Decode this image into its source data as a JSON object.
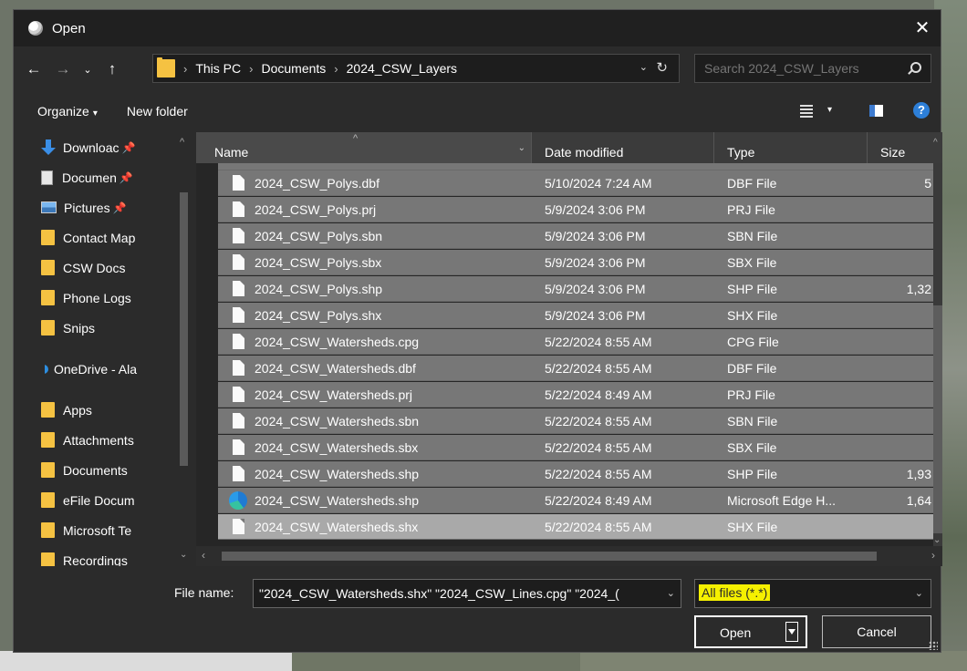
{
  "window": {
    "title": "Open",
    "close_glyph": "✕",
    "icon": "app-icon"
  },
  "address": {
    "back_glyph": "←",
    "forward_glyph": "→",
    "recent_glyph": "⌄",
    "up_glyph": "↑",
    "crumb_sep": "›",
    "crumbs": [
      "This PC",
      "Documents",
      "2024_CSW_Layers"
    ],
    "dropdown_glyph": "⌄",
    "refresh_glyph": "↻",
    "search_placeholder": "Search 2024_CSW_Layers"
  },
  "toolbar": {
    "organize_label": "Organize",
    "new_folder_label": "New folder",
    "caret_glyph": "▾",
    "help_glyph": "?"
  },
  "nav": {
    "pin_glyph": "📌",
    "items": [
      {
        "label": "Downloac",
        "icon": "download-icon",
        "pinned": true
      },
      {
        "label": "Documen",
        "icon": "documents-icon",
        "pinned": true
      },
      {
        "label": "Pictures",
        "icon": "pictures-icon",
        "pinned": true
      },
      {
        "label": "Contact Map",
        "icon": "folder-icon"
      },
      {
        "label": "CSW Docs",
        "icon": "folder-icon"
      },
      {
        "label": "Phone Logs",
        "icon": "folder-icon"
      },
      {
        "label": "Snips",
        "icon": "folder-icon"
      },
      {
        "label": "OneDrive - Ala",
        "icon": "onedrive-icon"
      },
      {
        "label": "Apps",
        "icon": "folder-icon"
      },
      {
        "label": "Attachments",
        "icon": "folder-icon"
      },
      {
        "label": "Documents",
        "icon": "folder-icon"
      },
      {
        "label": "eFile Docum",
        "icon": "folder-icon"
      },
      {
        "label": "Microsoft Te",
        "icon": "folder-icon"
      },
      {
        "label": "Recordings",
        "icon": "folder-icon"
      }
    ]
  },
  "columns": {
    "name": "Name",
    "date": "Date modified",
    "type": "Type",
    "size": "Size"
  },
  "files": [
    {
      "name": "2024_CSW_Polys.dbf",
      "date": "5/10/2024 7:24 AM",
      "type": "DBF File",
      "size": "5",
      "icon": "file-icon"
    },
    {
      "name": "2024_CSW_Polys.prj",
      "date": "5/9/2024 3:06 PM",
      "type": "PRJ File",
      "size": "",
      "icon": "file-icon"
    },
    {
      "name": "2024_CSW_Polys.sbn",
      "date": "5/9/2024 3:06 PM",
      "type": "SBN File",
      "size": "",
      "icon": "file-icon"
    },
    {
      "name": "2024_CSW_Polys.sbx",
      "date": "5/9/2024 3:06 PM",
      "type": "SBX File",
      "size": "",
      "icon": "file-icon"
    },
    {
      "name": "2024_CSW_Polys.shp",
      "date": "5/9/2024 3:06 PM",
      "type": "SHP File",
      "size": "1,32",
      "icon": "file-icon"
    },
    {
      "name": "2024_CSW_Polys.shx",
      "date": "5/9/2024 3:06 PM",
      "type": "SHX File",
      "size": "",
      "icon": "file-icon"
    },
    {
      "name": "2024_CSW_Watersheds.cpg",
      "date": "5/22/2024 8:55 AM",
      "type": "CPG File",
      "size": "",
      "icon": "file-icon"
    },
    {
      "name": "2024_CSW_Watersheds.dbf",
      "date": "5/22/2024 8:55 AM",
      "type": "DBF File",
      "size": "",
      "icon": "file-icon"
    },
    {
      "name": "2024_CSW_Watersheds.prj",
      "date": "5/22/2024 8:49 AM",
      "type": "PRJ File",
      "size": "",
      "icon": "file-icon"
    },
    {
      "name": "2024_CSW_Watersheds.sbn",
      "date": "5/22/2024 8:55 AM",
      "type": "SBN File",
      "size": "",
      "icon": "file-icon"
    },
    {
      "name": "2024_CSW_Watersheds.sbx",
      "date": "5/22/2024 8:55 AM",
      "type": "SBX File",
      "size": "",
      "icon": "file-icon"
    },
    {
      "name": "2024_CSW_Watersheds.shp",
      "date": "5/22/2024 8:55 AM",
      "type": "SHP File",
      "size": "1,93",
      "icon": "file-icon"
    },
    {
      "name": "2024_CSW_Watersheds.shp",
      "date": "5/22/2024 8:49 AM",
      "type": "Microsoft Edge H...",
      "size": "1,64",
      "icon": "edge-icon"
    },
    {
      "name": "2024_CSW_Watersheds.shx",
      "date": "5/22/2024 8:55 AM",
      "type": "SHX File",
      "size": "",
      "icon": "file-icon"
    }
  ],
  "bottom": {
    "filename_label": "File name:",
    "filename_value": "\"2024_CSW_Watersheds.shx\" \"2024_CSW_Lines.cpg\" \"2024_(",
    "filter_value": "All files (*.*)",
    "open_label": "Open",
    "cancel_label": "Cancel",
    "dropdown_glyph": "⌄"
  },
  "colors": {
    "dialog_bg": "#2b2b2b",
    "selection": "#777777",
    "highlight": "#f5f000",
    "folder": "#f5c242"
  }
}
